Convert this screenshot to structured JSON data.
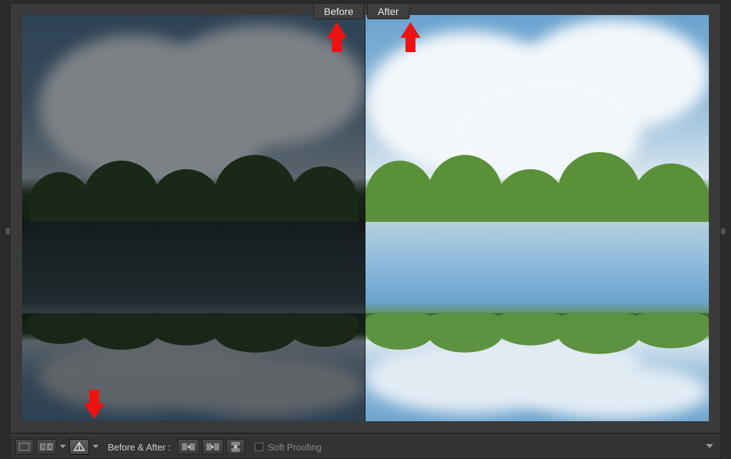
{
  "labels": {
    "before": "Before",
    "after": "After"
  },
  "toolbar": {
    "before_after_label": "Before & After :",
    "soft_proofing_label": "Soft Proofing"
  },
  "icons": {
    "loupe": "loupe-view-icon",
    "grid": "grid-compare-icon",
    "ba_split": "before-after-split-icon",
    "swap_lr": "swap-left-right-icon",
    "copy_lr": "copy-left-right-icon",
    "swap_tb": "swap-top-bottom-icon"
  },
  "annotations": {
    "arrow_before": "pointer to Before tab",
    "arrow_after": "pointer to After tab",
    "arrow_tool": "pointer to Before/After view button"
  }
}
